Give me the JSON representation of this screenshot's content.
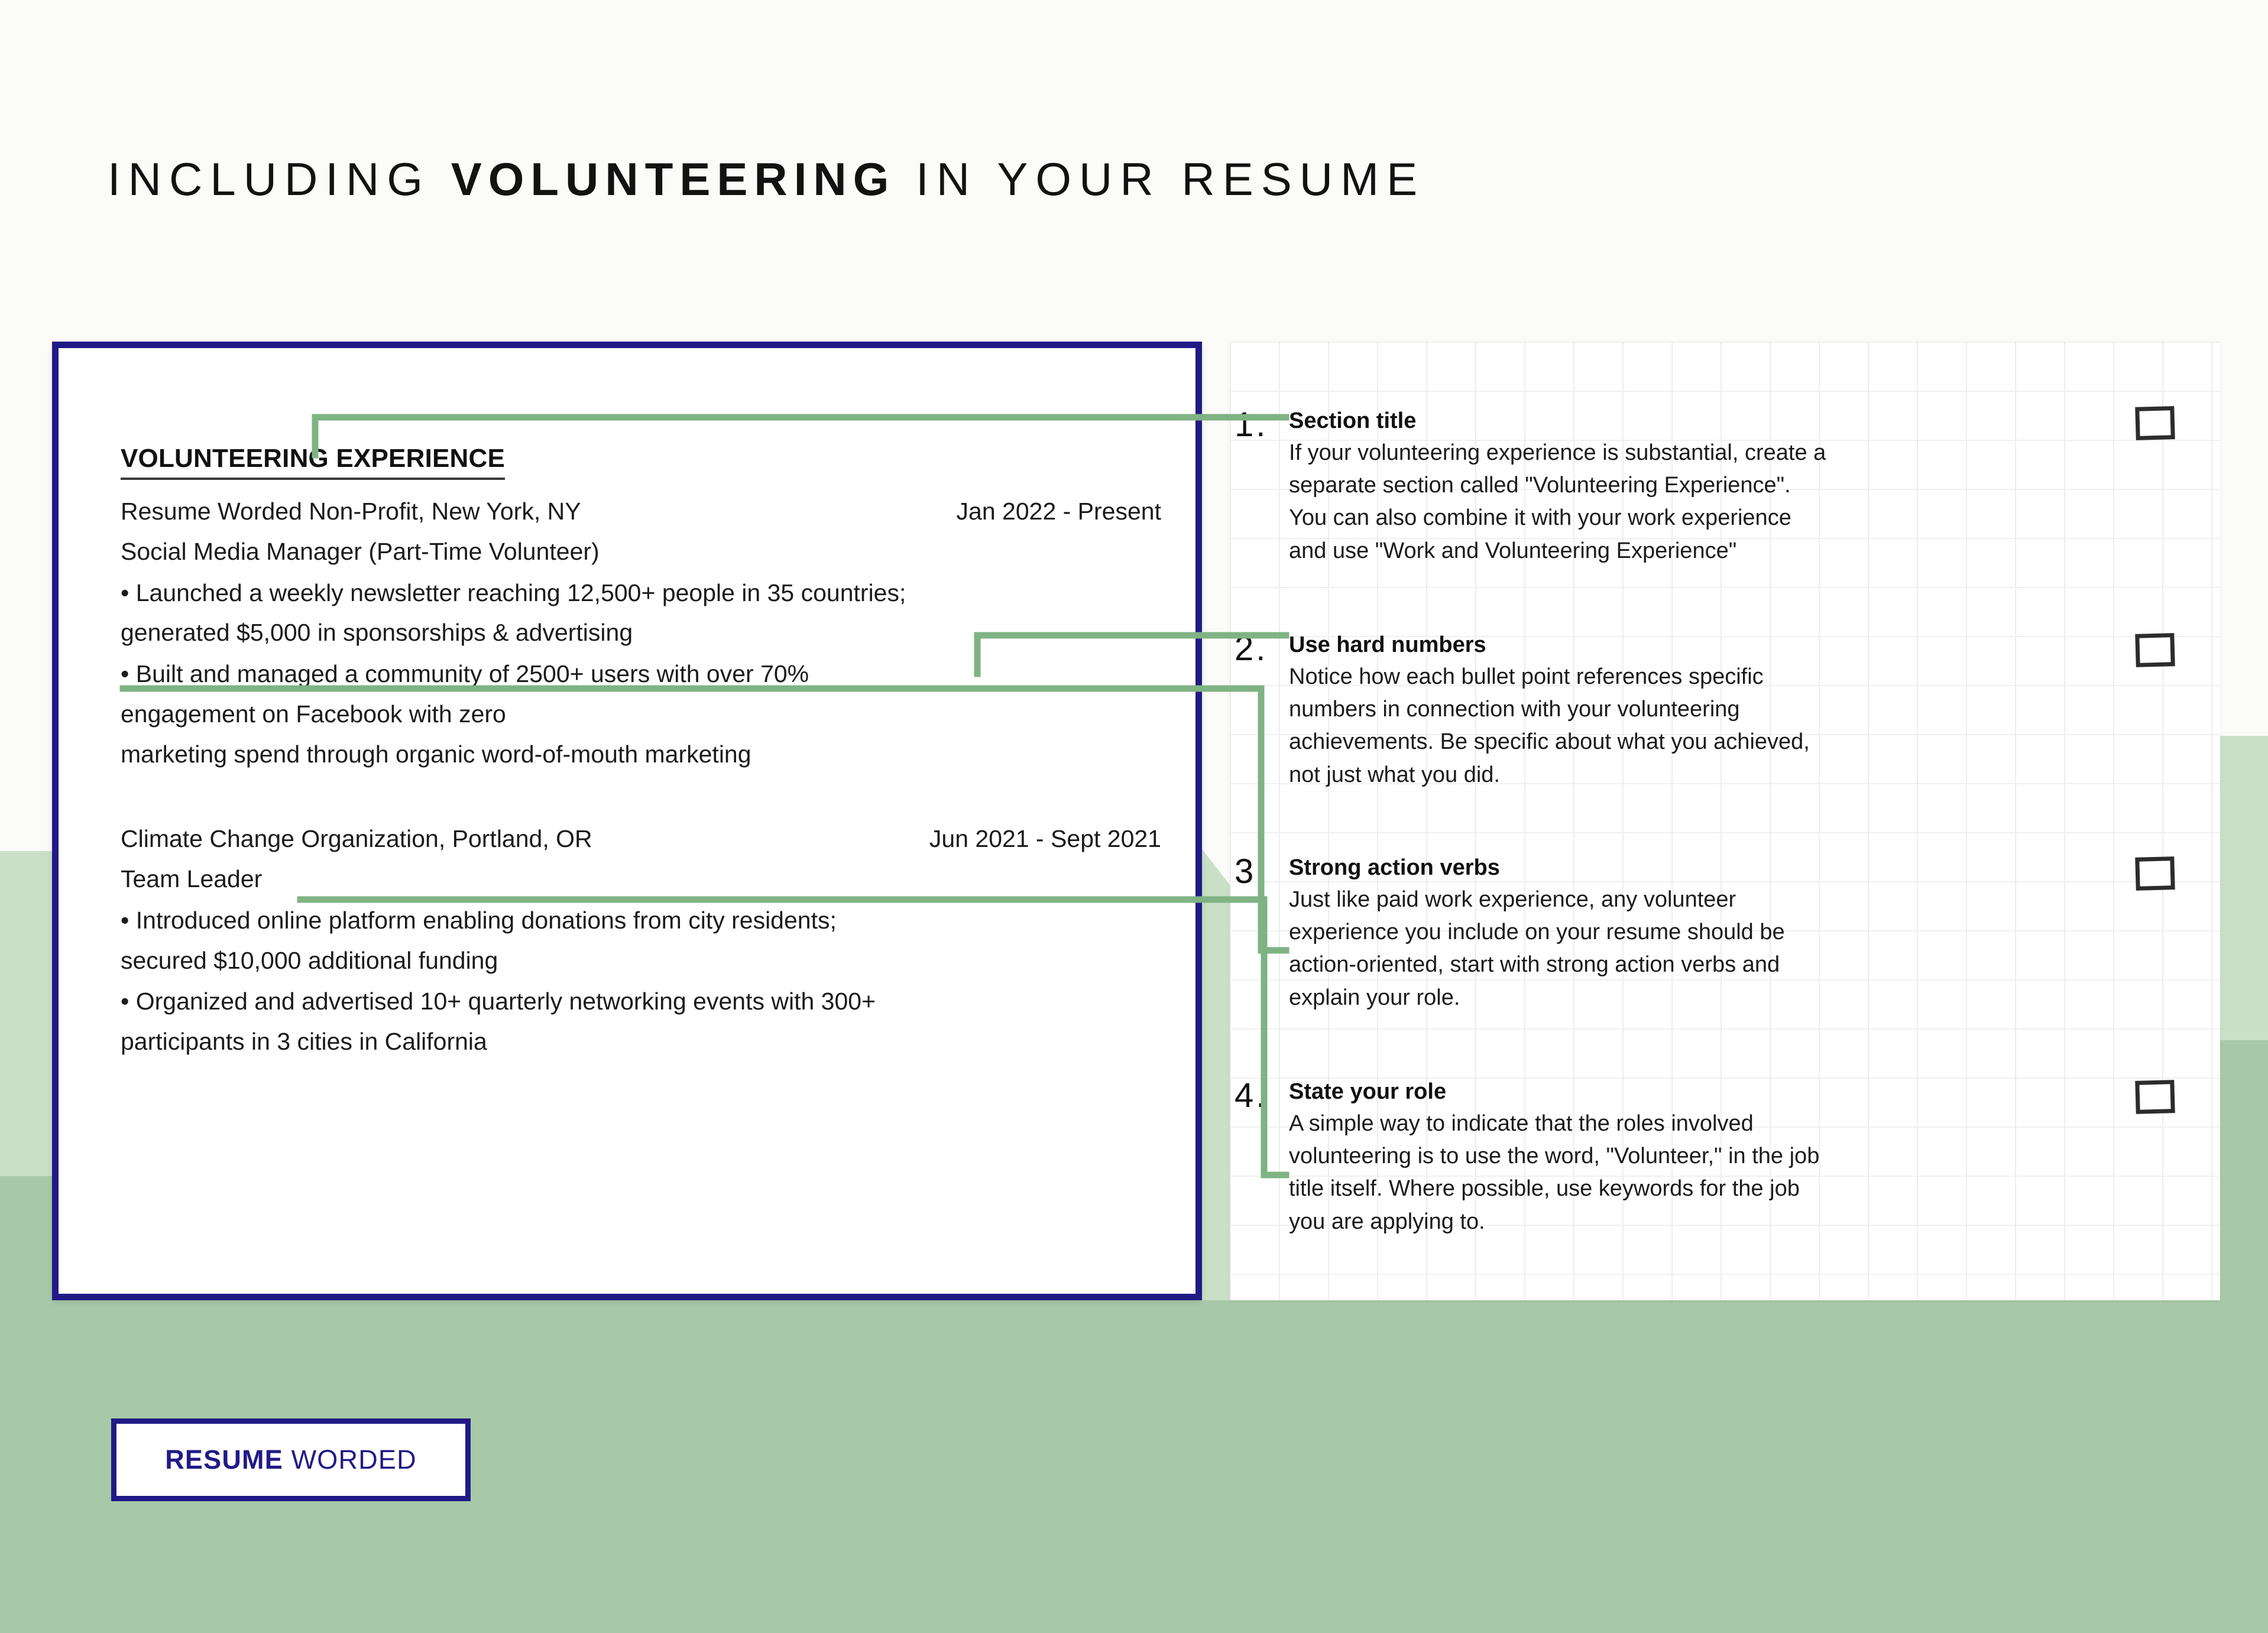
{
  "header": {
    "title_prefix": "INCLUDING ",
    "title_emphasis": "VOLUNTEERING",
    "title_suffix": " IN YOUR RESUME"
  },
  "resume": {
    "section_title": "VOLUNTEERING EXPERIENCE",
    "entries": [
      {
        "organization": "Resume Worded Non-Profit, New York, NY",
        "dates": "Jan 2022 - Present",
        "role": "Social Media Manager (Part-Time Volunteer)",
        "bullets": [
          "• Launched a weekly newsletter reaching 12,500+ people in 35 countries;",
          "generated $5,000 in sponsorships & advertising",
          "• Built and managed a community of 2500+ users with over 70%",
          "engagement on Facebook with zero",
          "marketing spend through organic word-of-mouth marketing"
        ]
      },
      {
        "organization": "Climate Change Organization, Portland, OR",
        "dates": "Jun 2021 - Sept 2021",
        "role": "Team Leader",
        "bullets": [
          "• Introduced online platform enabling donations from city residents;",
          "secured $10,000 additional funding",
          "• Organized and advertised 10+ quarterly networking events with 300+",
          "participants in 3 cities in California"
        ]
      }
    ]
  },
  "notes": [
    {
      "number": "1.",
      "heading": "Section title",
      "lines": [
        "If your volunteering experience is substantial, create a",
        "separate section called \"Volunteering Experience\".",
        "You can also combine it with your work experience",
        "and use \"Work and Volunteering Experience\""
      ]
    },
    {
      "number": "2.",
      "heading": "Use hard numbers",
      "lines": [
        "Notice how each bullet point references specific",
        "numbers in connection with your volunteering",
        "achievements. Be specific about what you achieved,",
        "not just what you did."
      ]
    },
    {
      "number": "3.",
      "heading": "Strong action verbs",
      "lines": [
        "Just like paid work experience, any volunteer",
        "experience you include on your resume should be",
        "action-oriented, start with strong action verbs and",
        "explain your role."
      ]
    },
    {
      "number": "4.",
      "heading": "State your role",
      "lines": [
        "A simple way to indicate that the roles involved",
        "volunteering is to use the word, \"Volunteer,\" in the job",
        "title itself. Where possible, use keywords for the job",
        "you are applying to."
      ]
    }
  ],
  "logo": {
    "bold_word": "RESUME",
    "light_word": " WORDED"
  },
  "colors": {
    "brand_navy": "#211a86",
    "connector_green": "#7fb383",
    "background_green": "#a8c9a8",
    "background_green_light": "#c9e0c7",
    "page_background": "#fbfbf9"
  }
}
